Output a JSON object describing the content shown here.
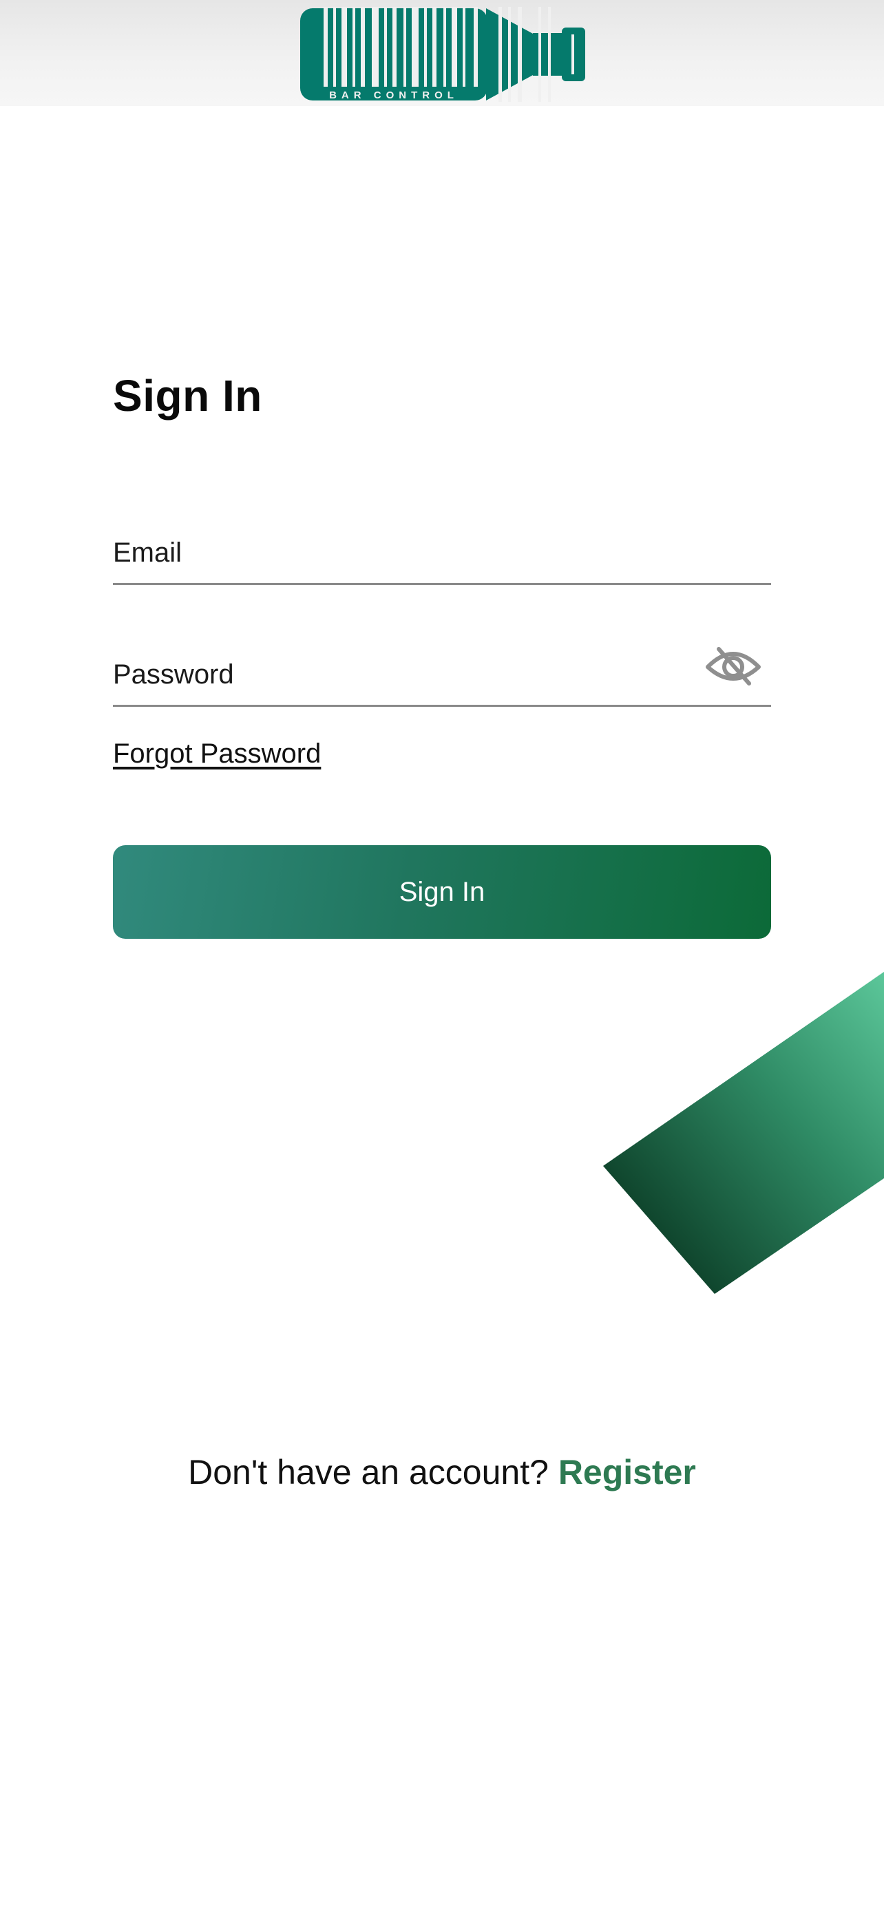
{
  "header": {
    "logo_text": "BAR CONTROL",
    "brand_color": "#057a6c"
  },
  "signin": {
    "title": "Sign In",
    "email_placeholder": "Email",
    "password_placeholder": "Password",
    "password_toggle_icon": "eye-off-icon",
    "forgot_password": "Forgot Password",
    "button_label": "Sign In",
    "button_gradient": [
      "#318a7d",
      "#0c6a38"
    ]
  },
  "footer": {
    "prompt": "Don't have an account?",
    "register_link": "Register",
    "link_color": "#2e7a52"
  }
}
